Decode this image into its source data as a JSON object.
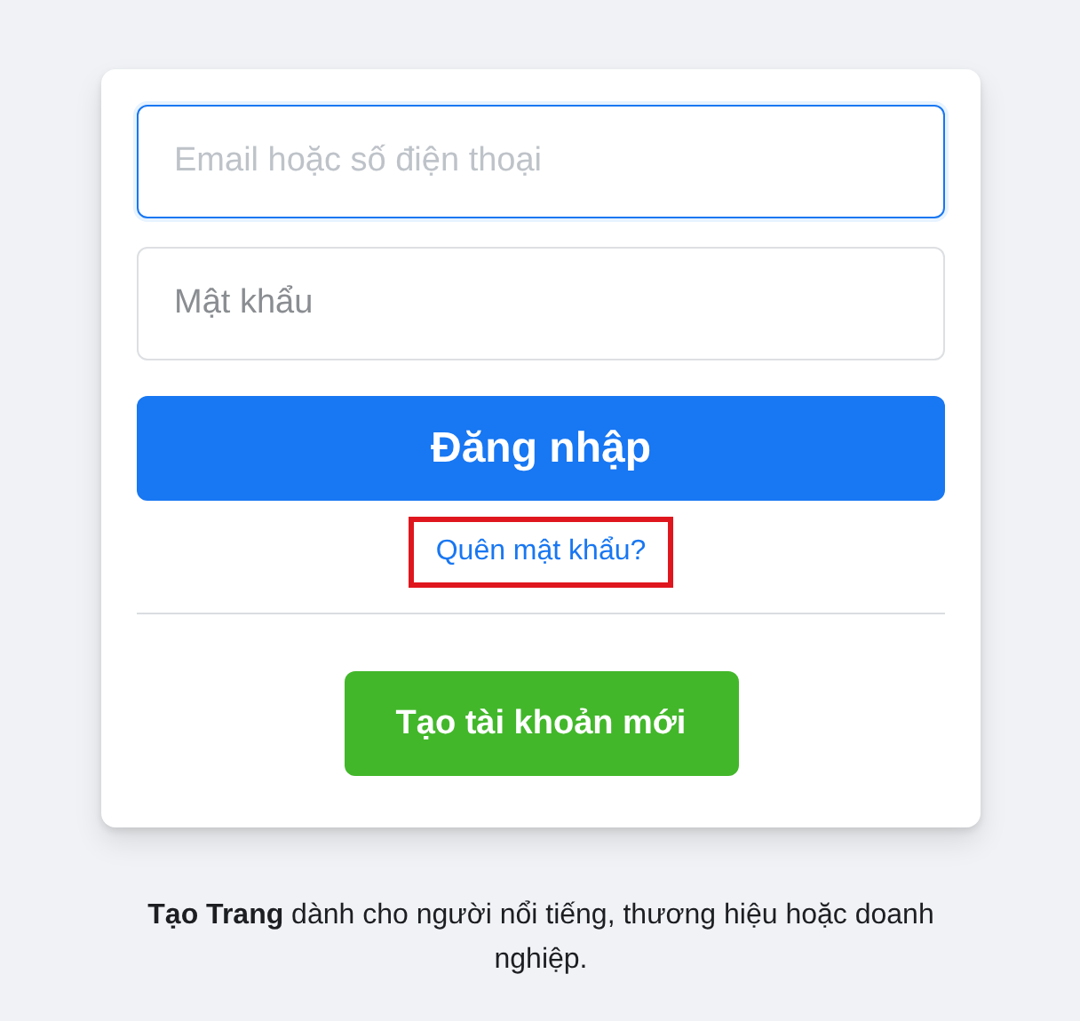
{
  "login_form": {
    "email_field": {
      "placeholder": "Email hoặc số điện thoại",
      "focused": true
    },
    "password_field": {
      "placeholder": "Mật khẩu"
    },
    "login_button": "Đăng nhập",
    "forgot_link": {
      "label": "Quên mật khẩu?",
      "highlighted": true
    },
    "create_account_button": "Tạo tài khoản mới"
  },
  "footer_note": "**Tạo Trang** dành cho người nổi tiếng, thương hiệu hoặc doanh nghiệp."
}
